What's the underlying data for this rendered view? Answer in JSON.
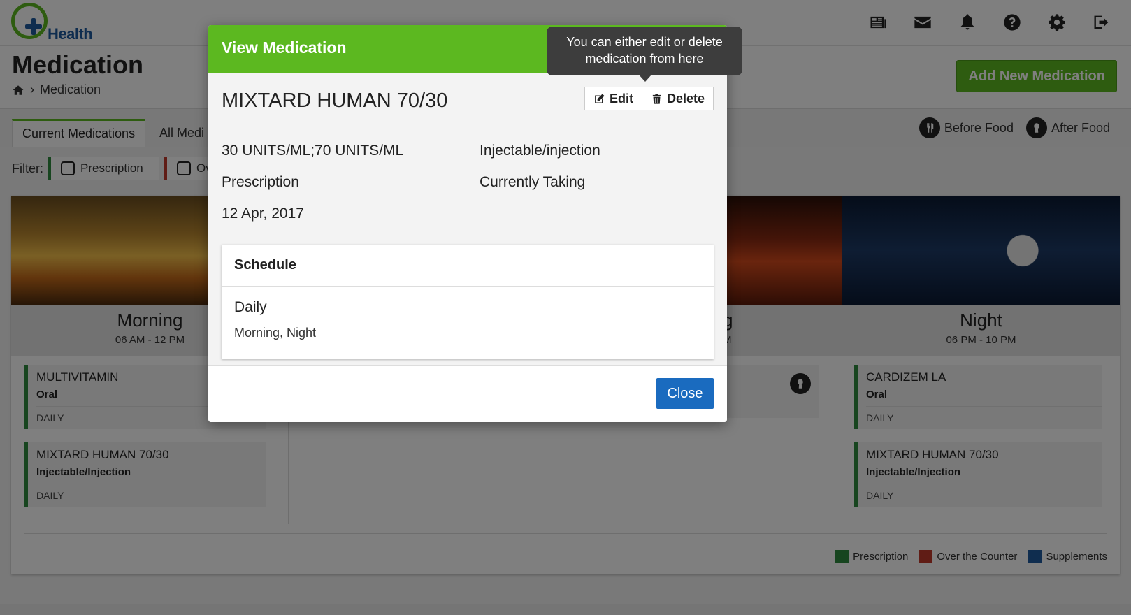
{
  "app": {
    "brand": "Health"
  },
  "nav": {
    "icons": [
      "news-icon",
      "mail-icon",
      "bell-icon",
      "help-icon",
      "settings-icon",
      "logout-icon"
    ]
  },
  "page": {
    "title": "Medication",
    "breadcrumb": "Medication",
    "add_button": "Add New Medication"
  },
  "tabs": {
    "active": "Current Medications",
    "other": "All Medi"
  },
  "food_legend": {
    "before": "Before Food",
    "after": "After Food"
  },
  "filter": {
    "label": "Filter:",
    "prescription": "Prescription",
    "over_counter": "Ov"
  },
  "slots": {
    "morning": {
      "name": "Morning",
      "time": "06 AM - 12 PM"
    },
    "evening": {
      "name": "g",
      "time": "M"
    },
    "night": {
      "name": "Night",
      "time": "06 PM - 10 PM"
    }
  },
  "medications": {
    "morning": [
      {
        "name": "MULTIVITAMIN",
        "route": "Oral",
        "freq": "DAILY"
      },
      {
        "name": "MIXTARD HUMAN 70/30",
        "route": "Injectable/Injection",
        "freq": "DAILY"
      }
    ],
    "night": [
      {
        "name": "CARDIZEM LA",
        "route": "Oral",
        "freq": "DAILY"
      },
      {
        "name": "MIXTARD HUMAN 70/30",
        "route": "Injectable/Injection",
        "freq": "DAILY"
      }
    ]
  },
  "legend": {
    "prescription": "Prescription",
    "over_counter": "Over the Counter",
    "supplements": "Supplements"
  },
  "colors": {
    "brand_green": "#5cb820",
    "prescription": "#2e8b3e",
    "over_counter": "#c0392b",
    "supplements": "#1f5a9e",
    "primary_blue": "#1a6bbf"
  },
  "modal": {
    "title": "View Medication",
    "med_name": "MIXTARD HUMAN 70/30",
    "edit": "Edit",
    "delete": "Delete",
    "strength": "30 UNITS/ML;70 UNITS/ML",
    "form": "Injectable/injection",
    "type": "Prescription",
    "status": "Currently Taking",
    "date": "12 Apr, 2017",
    "schedule_title": "Schedule",
    "schedule_freq": "Daily",
    "schedule_times": "Morning, Night",
    "close": "Close"
  },
  "tooltip": {
    "line1": "You can either edit or delete",
    "line2": "medication from here"
  }
}
